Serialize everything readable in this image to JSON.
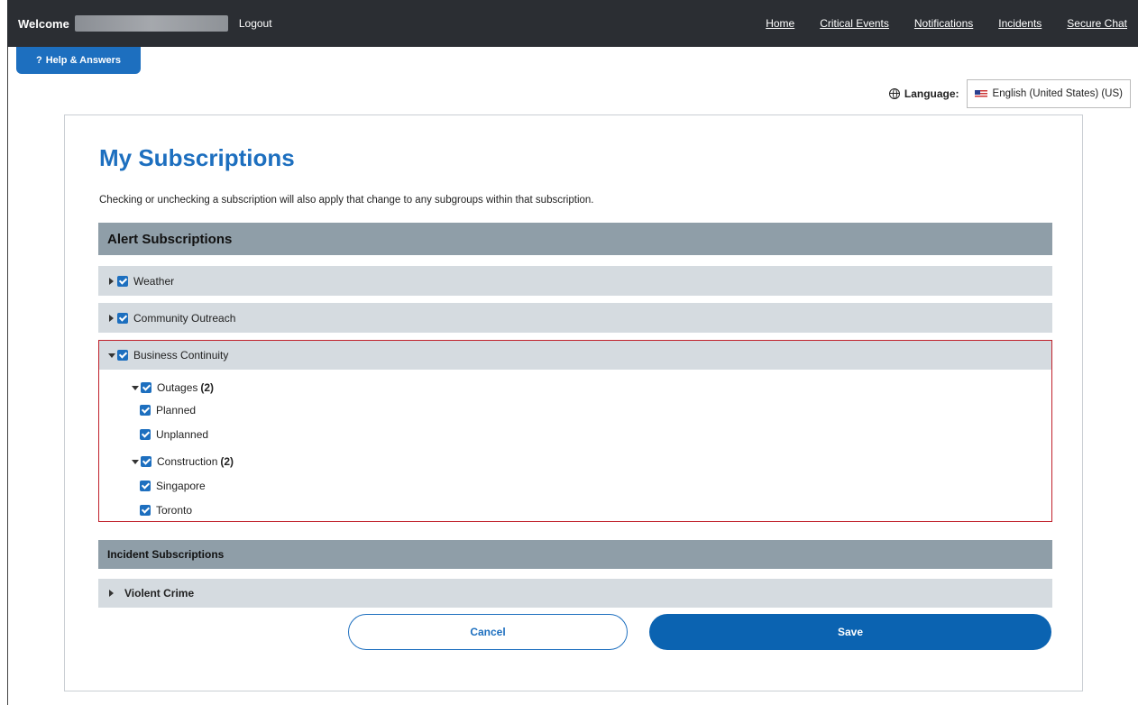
{
  "header": {
    "welcome": "Welcome",
    "logout": "Logout",
    "nav": [
      "Home",
      "Critical Events",
      "Notifications",
      "Incidents",
      "Secure Chat"
    ]
  },
  "help": {
    "label": "Help & Answers",
    "icon": "?"
  },
  "language": {
    "label": "Language:",
    "value": "English (United States) (US)"
  },
  "page": {
    "title": "My Subscriptions",
    "description": "Checking or unchecking a subscription will also apply that change to any subgroups within that subscription."
  },
  "alert_section": {
    "title": "Alert Subscriptions",
    "groups": [
      "Weather",
      "Community Outreach",
      "Business Continuity"
    ],
    "subgroups": [
      {
        "label": "Outages",
        "count": "(2)",
        "items": [
          "Planned",
          "Unplanned"
        ]
      },
      {
        "label": "Construction",
        "count": "(2)",
        "items": [
          "Singapore",
          "Toronto"
        ]
      }
    ]
  },
  "incident_section": {
    "title": "Incident Subscriptions",
    "groups": [
      "Violent Crime"
    ]
  },
  "actions": {
    "cancel": "Cancel",
    "save": "Save"
  },
  "colors": {
    "brand_blue": "#1d6fbf",
    "section_grey": "#8f9ea8",
    "row_grey": "#d5dbe0",
    "highlight_red": "#c0212b"
  }
}
